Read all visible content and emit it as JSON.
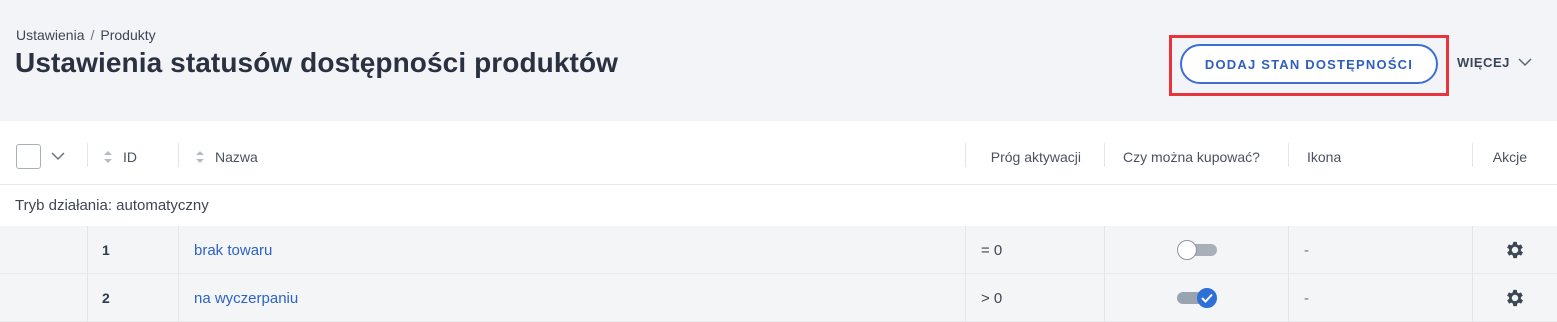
{
  "breadcrumb": {
    "items": [
      "Ustawienia",
      "Produkty"
    ],
    "separator": "/"
  },
  "page_title": "Ustawienia statusów dostępności produktów",
  "actions": {
    "add_label": "DODAJ STAN DOSTĘPNOŚCI",
    "more_label": "WIĘCEJ"
  },
  "table": {
    "columns": {
      "id": "ID",
      "name": "Nazwa",
      "threshold": "Próg aktywacji",
      "can_buy": "Czy można kupować?",
      "icon": "Ikona",
      "actions": "Akcje"
    },
    "group_label": "Tryb działania: automatyczny",
    "rows": [
      {
        "id": "1",
        "name": "brak towaru",
        "threshold": "= 0",
        "can_buy": false,
        "icon": "-"
      },
      {
        "id": "2",
        "name": "na wyczerpaniu",
        "threshold": "> 0",
        "can_buy": true,
        "icon": "-"
      }
    ]
  },
  "colors": {
    "accent": "#2f6fd8",
    "highlight_frame": "#e8343a",
    "header_bg": "#f3f4f7"
  }
}
